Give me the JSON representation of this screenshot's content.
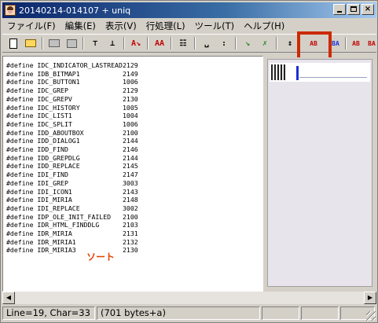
{
  "window": {
    "title": "20140214-014107 + uniq"
  },
  "title_buttons": {
    "minimize": "",
    "maximize": "",
    "close": "×"
  },
  "menu": [
    "ファイル(F)",
    "編集(E)",
    "表示(V)",
    "行処理(L)",
    "ツール(T)",
    "ヘルプ(H)"
  ],
  "toolbar": {
    "buttons": [
      {
        "name": "new-file-icon"
      },
      {
        "name": "open-folder-icon"
      },
      {
        "name": "print-icon"
      },
      {
        "name": "print-preview-icon"
      },
      {
        "name": "move-top-icon",
        "glyph": "⊤"
      },
      {
        "name": "move-bottom-icon",
        "glyph": "⊥"
      },
      {
        "name": "sort-ascending-icon",
        "glyph": "A↘",
        "color": "#c00000"
      },
      {
        "name": "uppercase-icon",
        "glyph": "AA",
        "color": "#c00000"
      },
      {
        "name": "columns-icon",
        "glyph": "☷"
      },
      {
        "name": "space-icon",
        "glyph": "␣"
      },
      {
        "name": "colon-icon",
        "glyph": ":"
      },
      {
        "name": "apply-icon",
        "glyph": "↘",
        "color": "#2a8a2a"
      },
      {
        "name": "remove-icon",
        "glyph": "✗",
        "color": "#2a8a2a"
      },
      {
        "name": "swap-updown-icon",
        "glyph": "↕"
      },
      {
        "name": "sort-ab-icon",
        "glyph": "AB",
        "color": "#c00000"
      },
      {
        "name": "sort-ba-icon",
        "glyph": "BA",
        "color": "#1a2fd8"
      },
      {
        "name": "reverse-ab-icon",
        "glyph": "AB",
        "color": "#c00000"
      },
      {
        "name": "reverse-ba-icon",
        "glyph": "BA",
        "color": "#c00000"
      }
    ]
  },
  "editor": {
    "lines": [
      {
        "name": "#define IDC_INDICATOR_LASTREAD",
        "value": "2129"
      },
      {
        "name": "#define IDB_BITMAP1",
        "value": "2149"
      },
      {
        "name": "#define IDC_BUTTON1",
        "value": "1006"
      },
      {
        "name": "#define IDC_GREP",
        "value": "2129"
      },
      {
        "name": "#define IDC_GREPV",
        "value": "2130"
      },
      {
        "name": "#define IDC_HISTORY",
        "value": "1005"
      },
      {
        "name": "#define IDC_LIST1",
        "value": "1004"
      },
      {
        "name": "#define IDC_SPLIT",
        "value": "1006"
      },
      {
        "name": "#define IDD_ABOUTBOX",
        "value": "2100"
      },
      {
        "name": "#define IDD_DIALOG1",
        "value": "2144"
      },
      {
        "name": "#define IDD_FIND",
        "value": "2146"
      },
      {
        "name": "#define IDD_GREPDLG",
        "value": "2144"
      },
      {
        "name": "#define IDD_REPLACE",
        "value": "2145"
      },
      {
        "name": "#define IDI_FIND",
        "value": "2147"
      },
      {
        "name": "#define IDI_GREP",
        "value": "3003"
      },
      {
        "name": "#define IDI_ICON1",
        "value": "2143"
      },
      {
        "name": "#define IDI_MIRIA",
        "value": "2148"
      },
      {
        "name": "#define IDI_REPLACE",
        "value": "3002"
      },
      {
        "name": "#define IDP_OLE_INIT_FAILED",
        "value": "2100"
      },
      {
        "name": "#define IDR_HTML_FINDDLG",
        "value": "2103"
      },
      {
        "name": "#define IDR_MIRIA",
        "value": "2131"
      },
      {
        "name": "#define IDR_MIRIA1",
        "value": "2132"
      },
      {
        "name": "#define IDR_MIRIA3",
        "value": "2130"
      }
    ],
    "caption": "ソート"
  },
  "scrollbar": {
    "left_arrow": "◀",
    "right_arrow": "▶"
  },
  "status": {
    "position": "Line=19, Char=33",
    "size": "(701 bytes+a)"
  },
  "colors": {
    "title_active": "#0a246a",
    "highlight_box": "#cc2a00",
    "caption_text": "#e34200",
    "cursor": "#1a2fd8"
  }
}
